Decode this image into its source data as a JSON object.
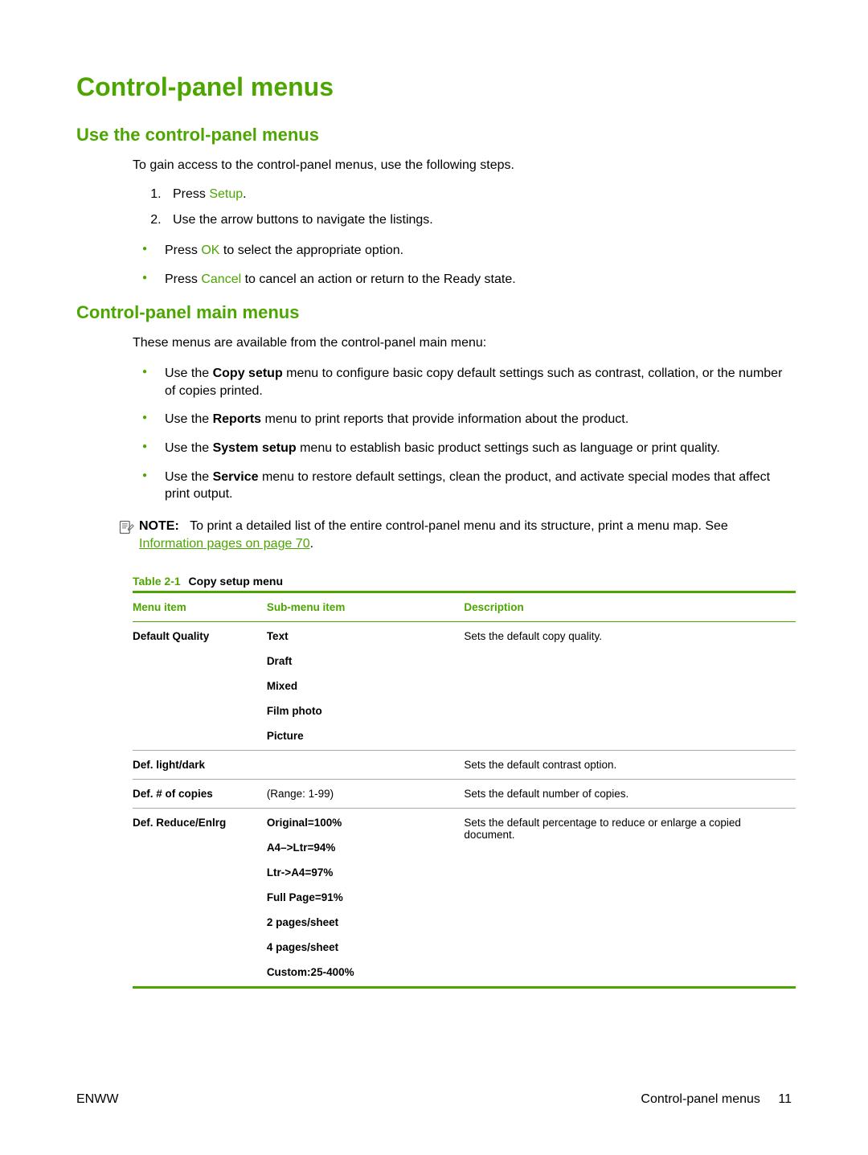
{
  "title": "Control-panel menus",
  "section1": {
    "heading": "Use the control-panel menus",
    "intro": "To gain access to the control-panel menus, use the following steps.",
    "step1_prefix": "Press ",
    "step1_button": "Setup",
    "step1_suffix": ".",
    "step2": "Use the arrow buttons to navigate the listings.",
    "bullet1_prefix": "Press ",
    "bullet1_button": "OK",
    "bullet1_suffix": " to select the appropriate option.",
    "bullet2_prefix": "Press ",
    "bullet2_button": "Cancel",
    "bullet2_suffix": " to cancel an action or return to the Ready state."
  },
  "section2": {
    "heading": "Control-panel main menus",
    "intro": "These menus are available from the control-panel main menu:",
    "b1_a": "Use the ",
    "b1_bold": "Copy setup",
    "b1_b": " menu to configure basic copy default settings such as contrast, collation, or the number of copies printed.",
    "b2_a": "Use the ",
    "b2_bold": "Reports",
    "b2_b": " menu to print reports that provide information about the product.",
    "b3_a": "Use the ",
    "b3_bold": "System setup",
    "b3_b": " menu to establish basic product settings such as language or print quality.",
    "b4_a": "Use the ",
    "b4_bold": "Service",
    "b4_b": " menu to restore default settings, clean the product, and activate special modes that affect print output."
  },
  "note": {
    "label": "NOTE:",
    "text_a": "To print a detailed list of the entire control-panel menu and its structure, print a menu map. See ",
    "link": "Information pages on page 70",
    "text_b": "."
  },
  "table": {
    "caption_label": "Table 2-1",
    "caption_title": "Copy setup menu",
    "headers": {
      "menu": "Menu item",
      "sub": "Sub-menu item",
      "desc": "Description"
    },
    "rows": {
      "r1": {
        "menu": "Default Quality",
        "subs": [
          "Text",
          "Draft",
          "Mixed",
          "Film photo",
          "Picture"
        ],
        "desc": "Sets the default copy quality."
      },
      "r2": {
        "menu": "Def. light/dark",
        "sub": "",
        "desc": "Sets the default contrast option."
      },
      "r3": {
        "menu": "Def. # of copies",
        "sub": "(Range: 1-99)",
        "desc": "Sets the default number of copies."
      },
      "r4": {
        "menu": "Def. Reduce/Enlrg",
        "subs": [
          "Original=100%",
          "A4–>Ltr=94%",
          "Ltr->A4=97%",
          "Full Page=91%",
          "2 pages/sheet",
          "4 pages/sheet",
          "Custom:25-400%"
        ],
        "desc": "Sets the default percentage to reduce or enlarge a copied document."
      }
    }
  },
  "footer": {
    "left": "ENWW",
    "right_text": "Control-panel menus",
    "page": "11"
  }
}
